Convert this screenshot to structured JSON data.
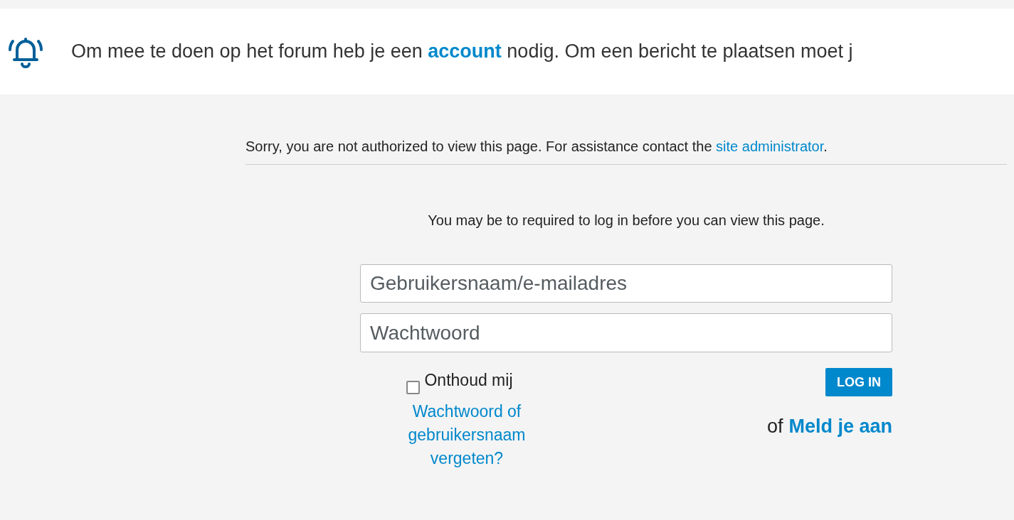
{
  "notice": {
    "text": "Om mee te doen op het forum heb je een **account** nodig. Om een bericht te plaatsen moet j"
  },
  "error": {
    "text": "Sorry, you are not authorized to view this page. For assistance contact the ",
    "link": "site administrator",
    "end": "."
  },
  "login": {
    "message": "You may be to required to log in before you can view this page.",
    "username": {
      "placeholder": "Gebruikersnaam/e-mailadres"
    },
    "password": {
      "placeholder": "Wachtwoord"
    },
    "remember": {
      "label": "Onthoud mij",
      "checked": false
    },
    "forgot_link": "Wachtwoord of gebruikersnaam vergeten?",
    "button": "LOG IN",
    "or": "of",
    "register_link": "Meld je aan"
  }
}
